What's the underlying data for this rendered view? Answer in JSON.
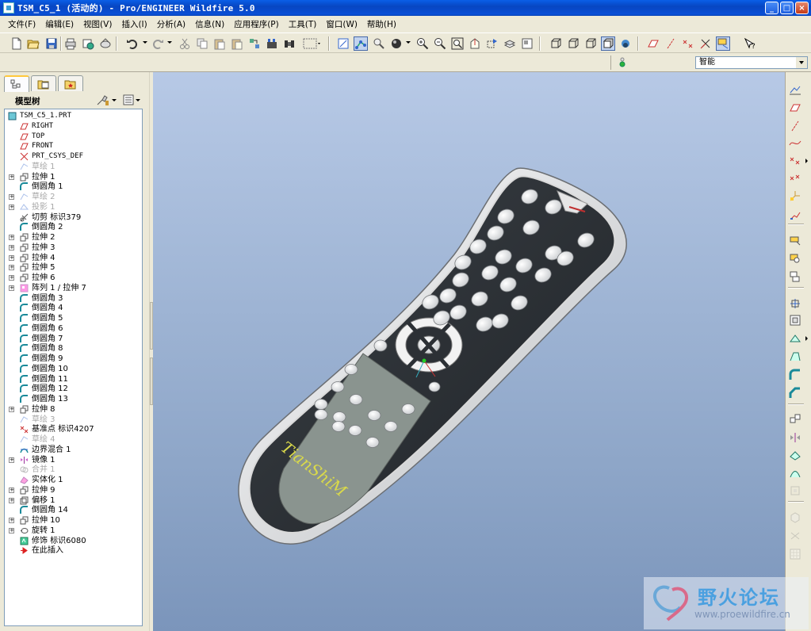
{
  "window": {
    "title": "TSM_C5_1 (活动的) - Pro/ENGINEER Wildfire 5.0",
    "minimize": "_",
    "maximize": "□",
    "close": "×"
  },
  "menu": [
    "文件(F)",
    "编辑(E)",
    "视图(V)",
    "插入(I)",
    "分析(A)",
    "信息(N)",
    "应用程序(P)",
    "工具(T)",
    "窗口(W)",
    "帮助(H)"
  ],
  "toolbar": {
    "icons": [
      "new-icon",
      "open-icon",
      "save-icon",
      "print-icon",
      "send-icon",
      "email-icon",
      "undo-icon",
      "redo-icon",
      "cut-icon",
      "copy-icon",
      "paste-icon",
      "paste-special-icon",
      "regenerate-icon",
      "find-icon",
      "select-box-icon",
      "view-manager-icon",
      "repaint-icon",
      "spin-center-icon",
      "orient-icon",
      "appearance-icon",
      "zoom-in-icon",
      "zoom-out-icon",
      "refit-icon",
      "reorient-icon",
      "saved-views-icon",
      "layers-icon",
      "view-manager-2-icon",
      "wireframe-icon",
      "hidden-line-icon",
      "no-hidden-icon",
      "shading-icon",
      "sketch-display-icon",
      "datum-planes-icon",
      "datum-axes-icon",
      "datum-points-icon",
      "coord-sys-icon",
      "datum-display-icon",
      "whats-this-icon"
    ]
  },
  "filter": {
    "selected": "智能"
  },
  "navigator": {
    "tree_title": "模型树",
    "tabs": [
      "model-tree-tab",
      "folder-tab",
      "favorites-tab"
    ]
  },
  "model_tree": [
    {
      "label": "TSM_C5_1.PRT",
      "icon": "part-icon",
      "level": 0,
      "expand": false,
      "suppressed": false,
      "mono": true
    },
    {
      "label": "RIGHT",
      "icon": "datum-plane-icon",
      "level": 1,
      "expand": false,
      "suppressed": false,
      "mono": true
    },
    {
      "label": "TOP",
      "icon": "datum-plane-icon",
      "level": 1,
      "expand": false,
      "suppressed": false,
      "mono": true
    },
    {
      "label": "FRONT",
      "icon": "datum-plane-icon",
      "level": 1,
      "expand": false,
      "suppressed": false,
      "mono": true
    },
    {
      "label": "PRT_CSYS_DEF",
      "icon": "csys-icon",
      "level": 1,
      "expand": false,
      "suppressed": false,
      "mono": true
    },
    {
      "label": "草绘 1",
      "icon": "sketch-icon",
      "level": 1,
      "expand": false,
      "suppressed": true,
      "mono": false
    },
    {
      "label": "拉伸 1",
      "icon": "extrude-icon",
      "level": 1,
      "expand": true,
      "suppressed": false,
      "mono": false
    },
    {
      "label": "倒圆角 1",
      "icon": "round-icon",
      "level": 1,
      "expand": false,
      "suppressed": false,
      "mono": false
    },
    {
      "label": "草绘 2",
      "icon": "sketch-icon",
      "level": 1,
      "expand": true,
      "suppressed": true,
      "mono": false
    },
    {
      "label": "投影 1",
      "icon": "project-icon",
      "level": 1,
      "expand": true,
      "suppressed": true,
      "mono": false
    },
    {
      "label": "切剪 标识379",
      "icon": "cut-feature-icon",
      "level": 1,
      "expand": false,
      "suppressed": false,
      "mono": false
    },
    {
      "label": "倒圆角 2",
      "icon": "round-icon",
      "level": 1,
      "expand": false,
      "suppressed": false,
      "mono": false
    },
    {
      "label": "拉伸 2",
      "icon": "extrude-icon",
      "level": 1,
      "expand": true,
      "suppressed": false,
      "mono": false
    },
    {
      "label": "拉伸 3",
      "icon": "extrude-icon",
      "level": 1,
      "expand": true,
      "suppressed": false,
      "mono": false
    },
    {
      "label": "拉伸 4",
      "icon": "extrude-icon",
      "level": 1,
      "expand": true,
      "suppressed": false,
      "mono": false
    },
    {
      "label": "拉伸 5",
      "icon": "extrude-icon",
      "level": 1,
      "expand": true,
      "suppressed": false,
      "mono": false
    },
    {
      "label": "拉伸 6",
      "icon": "extrude-icon",
      "level": 1,
      "expand": true,
      "suppressed": false,
      "mono": false
    },
    {
      "label": "阵列 1 / 拉伸 7",
      "icon": "pattern-icon",
      "level": 1,
      "expand": true,
      "suppressed": false,
      "mono": false
    },
    {
      "label": "倒圆角 3",
      "icon": "round-icon",
      "level": 1,
      "expand": false,
      "suppressed": false,
      "mono": false
    },
    {
      "label": "倒圆角 4",
      "icon": "round-icon",
      "level": 1,
      "expand": false,
      "suppressed": false,
      "mono": false
    },
    {
      "label": "倒圆角 5",
      "icon": "round-icon",
      "level": 1,
      "expand": false,
      "suppressed": false,
      "mono": false
    },
    {
      "label": "倒圆角 6",
      "icon": "round-icon",
      "level": 1,
      "expand": false,
      "suppressed": false,
      "mono": false
    },
    {
      "label": "倒圆角 7",
      "icon": "round-icon",
      "level": 1,
      "expand": false,
      "suppressed": false,
      "mono": false
    },
    {
      "label": "倒圆角 8",
      "icon": "round-icon",
      "level": 1,
      "expand": false,
      "suppressed": false,
      "mono": false
    },
    {
      "label": "倒圆角 9",
      "icon": "round-icon",
      "level": 1,
      "expand": false,
      "suppressed": false,
      "mono": false
    },
    {
      "label": "倒圆角 10",
      "icon": "round-icon",
      "level": 1,
      "expand": false,
      "suppressed": false,
      "mono": false
    },
    {
      "label": "倒圆角 11",
      "icon": "round-icon",
      "level": 1,
      "expand": false,
      "suppressed": false,
      "mono": false
    },
    {
      "label": "倒圆角 12",
      "icon": "round-icon",
      "level": 1,
      "expand": false,
      "suppressed": false,
      "mono": false
    },
    {
      "label": "倒圆角 13",
      "icon": "round-icon",
      "level": 1,
      "expand": false,
      "suppressed": false,
      "mono": false
    },
    {
      "label": "拉伸 8",
      "icon": "extrude-icon",
      "level": 1,
      "expand": true,
      "suppressed": false,
      "mono": false
    },
    {
      "label": "草绘 3",
      "icon": "sketch-icon",
      "level": 1,
      "expand": false,
      "suppressed": true,
      "mono": false
    },
    {
      "label": "基准点 标识4207",
      "icon": "datum-point-icon",
      "level": 1,
      "expand": false,
      "suppressed": false,
      "mono": false
    },
    {
      "label": "草绘 4",
      "icon": "sketch-icon",
      "level": 1,
      "expand": false,
      "suppressed": true,
      "mono": false
    },
    {
      "label": "边界混合 1",
      "icon": "boundary-blend-icon",
      "level": 1,
      "expand": false,
      "suppressed": false,
      "mono": false
    },
    {
      "label": "镜像 1",
      "icon": "mirror-icon",
      "level": 1,
      "expand": true,
      "suppressed": false,
      "mono": false
    },
    {
      "label": "合并 1",
      "icon": "merge-icon",
      "level": 1,
      "expand": false,
      "suppressed": true,
      "mono": false
    },
    {
      "label": "实体化 1",
      "icon": "solidify-icon",
      "level": 1,
      "expand": false,
      "suppressed": false,
      "mono": false
    },
    {
      "label": "拉伸 9",
      "icon": "extrude-icon",
      "level": 1,
      "expand": true,
      "suppressed": false,
      "mono": false
    },
    {
      "label": "偏移 1",
      "icon": "offset-icon",
      "level": 1,
      "expand": true,
      "suppressed": false,
      "mono": false
    },
    {
      "label": "倒圆角 14",
      "icon": "round-icon",
      "level": 1,
      "expand": false,
      "suppressed": false,
      "mono": false
    },
    {
      "label": "拉伸 10",
      "icon": "extrude-icon",
      "level": 1,
      "expand": true,
      "suppressed": false,
      "mono": false
    },
    {
      "label": "旋转 1",
      "icon": "revolve-icon",
      "level": 1,
      "expand": true,
      "suppressed": false,
      "mono": false
    },
    {
      "label": "修饰 标识6080",
      "icon": "cosmetic-icon",
      "level": 1,
      "expand": false,
      "suppressed": false,
      "mono": false
    },
    {
      "label": "在此插入",
      "icon": "insert-here-icon",
      "level": 1,
      "expand": false,
      "suppressed": false,
      "mono": false
    }
  ],
  "model": {
    "engraving": "TianShiM",
    "colors": {
      "body": "#2f3439",
      "rim": "#e6e6e6",
      "buttons": "#f2f2f2",
      "keypad": "#8c9690",
      "engraving": "#d9d94a"
    }
  },
  "right_toolbar": {
    "icons": [
      "sketch-view-icon",
      "datum-plane-tool-icon",
      "datum-axis-tool-icon",
      "datum-curve-tool-icon",
      "datum-point-tool-icon",
      "offset-point-tool-icon",
      "csys-tool-icon",
      "analysis-feature-icon",
      "place-icon",
      "copy-geometry-icon",
      "shrinkwrap-icon",
      "hole-tool-icon",
      "shell-tool-icon",
      "rib-tool-icon",
      "draft-tool-icon",
      "round-tool-icon",
      "chamfer-tool-icon",
      "pattern-tool-icon",
      "mirror-tool-icon",
      "merge-tool-icon",
      "trim-tool-icon",
      "offset-tool-icon",
      "thicken-tool-icon",
      "solidify-tool-icon",
      "project-tool-icon"
    ]
  },
  "watermark": {
    "title": "野火论坛",
    "url": "www.proewildfire.cn"
  }
}
